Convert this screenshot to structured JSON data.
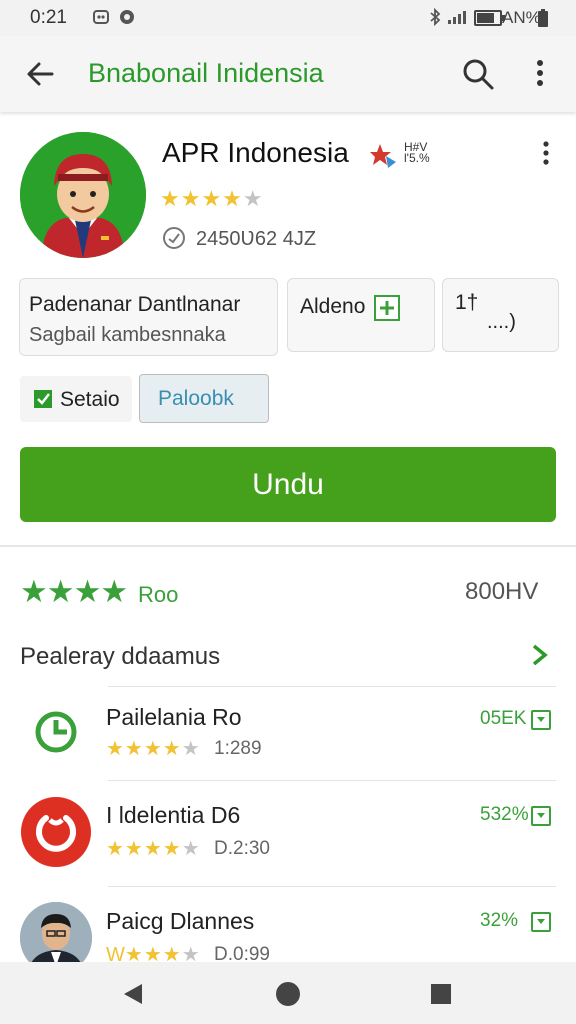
{
  "status_bar": {
    "time": "0:21",
    "battery": "AN%"
  },
  "toolbar": {
    "title": "Bnabonail Inidensia"
  },
  "app": {
    "name": "APR Indonesia",
    "badge_line1": "H#V",
    "badge_line2": "l'5.%",
    "rating_stars": 4,
    "downloads": "2450Ʋ62 4JZ"
  },
  "info_cards": {
    "developer_title": "Padenanar Dantlnanar",
    "developer_sub": "Sagbail kambesnnaka",
    "age_label": "Aldeno",
    "more_top": "1†",
    "more_bottom": "....)"
  },
  "chips": {
    "chip1": "Setaio",
    "chip2": "Paloobk"
  },
  "install_button": {
    "label": "Undu"
  },
  "summary": {
    "stars": 4,
    "rating_label": "Roo",
    "count": "800HV"
  },
  "section": {
    "title": "Pealeray ddaamus"
  },
  "list": [
    {
      "title": "Pailelania Ro",
      "rating": 4,
      "meta": "1:289",
      "size": "05EK"
    },
    {
      "title": "I ldelentia D6",
      "rating": 4,
      "meta": "D.2:30",
      "size": "532%"
    },
    {
      "title": "Paicg Dlannes",
      "rating_prefix": "W",
      "rating": 4,
      "meta": "D.0:99",
      "size": "32%"
    }
  ],
  "colors": {
    "brand_green": "#45a11c",
    "toolbar_green": "#2b9a2b",
    "star_gold": "#f1c232"
  },
  "icons": [
    "back-arrow-icon",
    "search-icon",
    "overflow-menu-icon",
    "share-icon",
    "checkbox-icon",
    "add-icon",
    "chevron-right-icon",
    "download-icon",
    "clock-icon",
    "power-icon",
    "nav-back-icon",
    "nav-home-icon",
    "nav-recents-icon"
  ]
}
